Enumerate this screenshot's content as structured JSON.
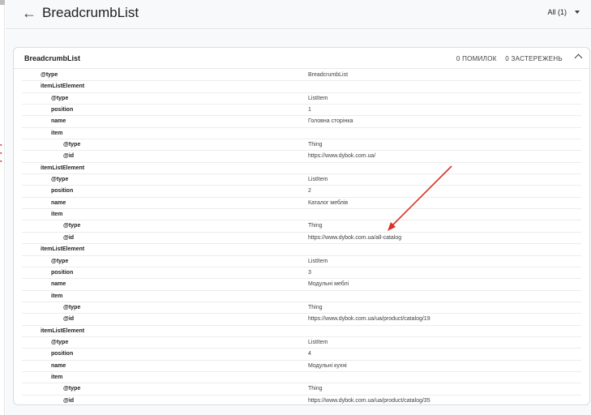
{
  "header": {
    "back_glyph": "←",
    "title": "BreadcrumbList",
    "filter_label": "All (1)"
  },
  "card": {
    "title": "BreadcrumbList",
    "errors": "0 ПОМИЛОК",
    "warnings": "0 ЗАСТЕРЕЖЕНЬ"
  },
  "rows": [
    {
      "key": "@type",
      "value": "BreadcrumbList",
      "level": 1
    },
    {
      "key": "itemListElement",
      "value": "",
      "level": 1
    },
    {
      "key": "@type",
      "value": "ListItem",
      "level": 2
    },
    {
      "key": "position",
      "value": "1",
      "level": 2
    },
    {
      "key": "name",
      "value": "Головна сторінка",
      "level": 2
    },
    {
      "key": "item",
      "value": "",
      "level": 2
    },
    {
      "key": "@type",
      "value": "Thing",
      "level": 3
    },
    {
      "key": "@id",
      "value": "https://www.dybok.com.ua/",
      "level": 3
    },
    {
      "key": "itemListElement",
      "value": "",
      "level": 1
    },
    {
      "key": "@type",
      "value": "ListItem",
      "level": 2
    },
    {
      "key": "position",
      "value": "2",
      "level": 2
    },
    {
      "key": "name",
      "value": "Каталог меблів",
      "level": 2
    },
    {
      "key": "item",
      "value": "",
      "level": 2
    },
    {
      "key": "@type",
      "value": "Thing",
      "level": 3
    },
    {
      "key": "@id",
      "value": "https://www.dybok.com.ua/all-catalog",
      "level": 3
    },
    {
      "key": "itemListElement",
      "value": "",
      "level": 1
    },
    {
      "key": "@type",
      "value": "ListItem",
      "level": 2
    },
    {
      "key": "position",
      "value": "3",
      "level": 2
    },
    {
      "key": "name",
      "value": "Модульні меблі",
      "level": 2
    },
    {
      "key": "item",
      "value": "",
      "level": 2
    },
    {
      "key": "@type",
      "value": "Thing",
      "level": 3
    },
    {
      "key": "@id",
      "value": "https://www.dybok.com.ua/ua/product/catalog/19",
      "level": 3
    },
    {
      "key": "itemListElement",
      "value": "",
      "level": 1
    },
    {
      "key": "@type",
      "value": "ListItem",
      "level": 2
    },
    {
      "key": "position",
      "value": "4",
      "level": 2
    },
    {
      "key": "name",
      "value": "Модульні кухні",
      "level": 2
    },
    {
      "key": "item",
      "value": "",
      "level": 2
    },
    {
      "key": "@type",
      "value": "Thing",
      "level": 3
    },
    {
      "key": "@id",
      "value": "https://www.dybok.com.ua/ua/product/catalog/35",
      "level": 3
    }
  ],
  "colors": {
    "annotation_arrow": "#d93025",
    "page_bg": "#f8f9fa",
    "card_border": "#dadce0"
  }
}
